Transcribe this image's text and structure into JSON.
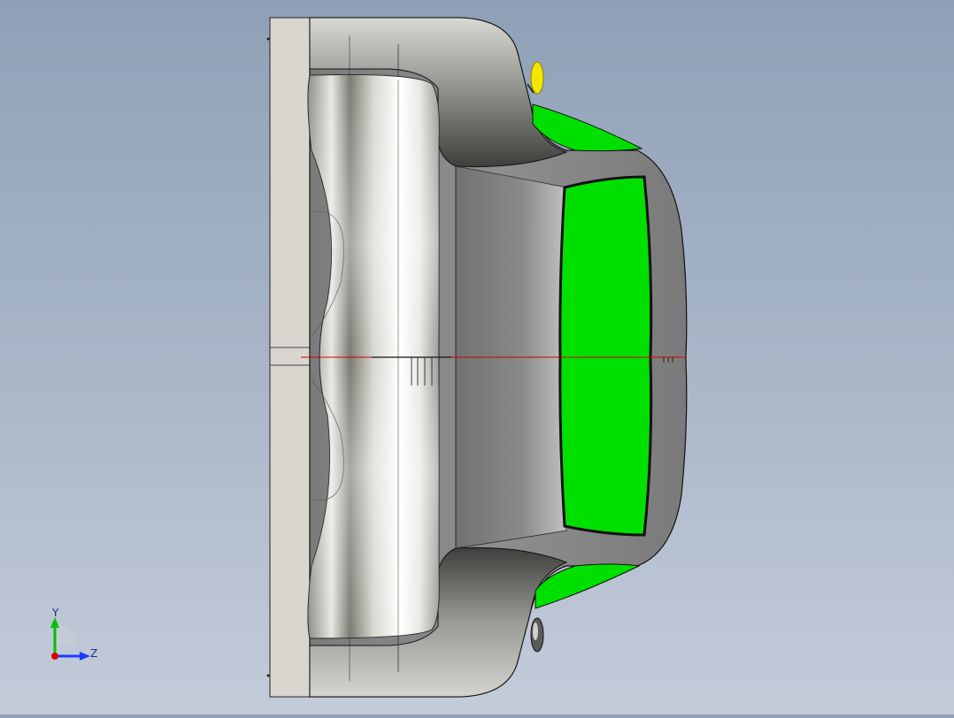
{
  "viewport": {
    "background_top": "#8fa0b6",
    "background_bottom": "#c3ccd9",
    "part_colors": {
      "body_shell": "#8a8a8a",
      "glass": "#00e000",
      "mirror_top": "#f2e600",
      "base_plate": "#d8d6cf",
      "section_line": "#d00000"
    }
  },
  "triad": {
    "y_label": "Y",
    "z_label": "Z",
    "y_color": "#00c000",
    "z_color": "#1e3cff",
    "origin_color": "#e00000"
  }
}
